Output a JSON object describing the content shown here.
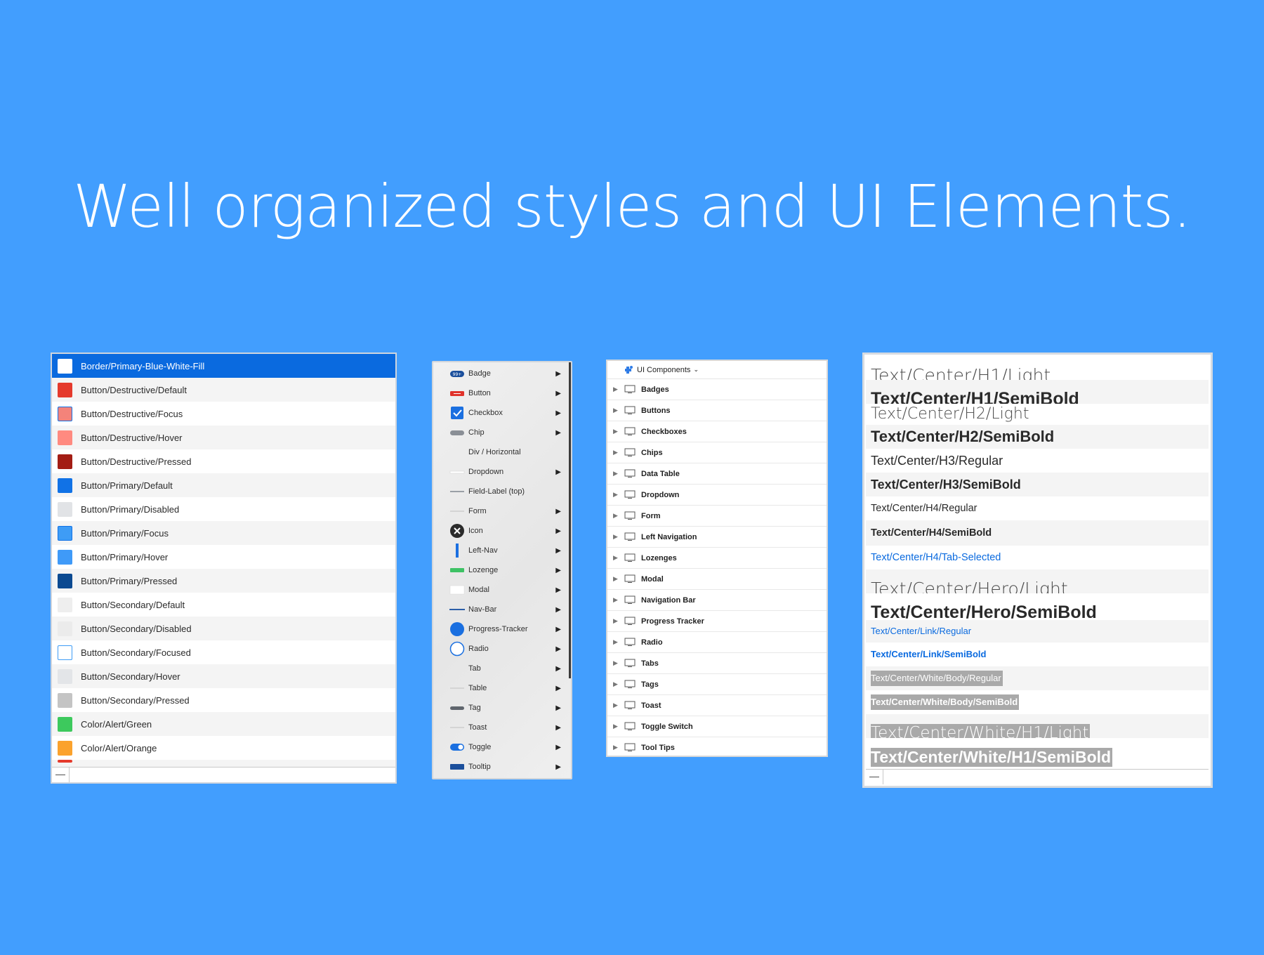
{
  "headline": "Well organized styles and UI Elements.",
  "colors": {
    "background": "#429EFE",
    "selected": "#0A6ADF",
    "link": "#0A6ADF",
    "highlight": "#A9A9A9"
  },
  "color_styles": {
    "items": [
      {
        "label": "Border/Primary-Blue-White-Fill",
        "swatch": "#FFFFFF",
        "selected": true
      },
      {
        "label": "Button/Destructive/Default",
        "swatch": "#E53A2C"
      },
      {
        "label": "Button/Destructive/Focus",
        "swatch": "#F4837A"
      },
      {
        "label": "Button/Destructive/Hover",
        "swatch": "#FF8A80"
      },
      {
        "label": "Button/Destructive/Pressed",
        "swatch": "#A31D14"
      },
      {
        "label": "Button/Primary/Default",
        "swatch": "#1172E6"
      },
      {
        "label": "Button/Primary/Disabled",
        "swatch": "#E1E3E6"
      },
      {
        "label": "Button/Primary/Focus",
        "swatch": "#3E9CF6"
      },
      {
        "label": "Button/Primary/Hover",
        "swatch": "#3F9AF8"
      },
      {
        "label": "Button/Primary/Pressed",
        "swatch": "#0C4A91"
      },
      {
        "label": "Button/Secondary/Default",
        "swatch": "#EEEEEE"
      },
      {
        "label": "Button/Secondary/Disabled",
        "swatch": "#EBEBEB"
      },
      {
        "label": "Button/Secondary/Focused",
        "swatch": "#FFFFFF"
      },
      {
        "label": "Button/Secondary/Hover",
        "swatch": "#E3E5E8"
      },
      {
        "label": "Button/Secondary/Pressed",
        "swatch": "#C4C4C4"
      },
      {
        "label": "Color/Alert/Green",
        "swatch": "#3DC95D"
      },
      {
        "label": "Color/Alert/Orange",
        "swatch": "#FBA22D"
      }
    ]
  },
  "component_menu": {
    "items": [
      {
        "label": "Badge",
        "icon": "badge-icon",
        "arrow": true
      },
      {
        "label": "Button",
        "icon": "button-icon",
        "arrow": true
      },
      {
        "label": "Checkbox",
        "icon": "checkbox-icon",
        "arrow": true
      },
      {
        "label": "Chip",
        "icon": "chip-icon",
        "arrow": true
      },
      {
        "label": "Div / Horizontal",
        "icon": "",
        "arrow": false
      },
      {
        "label": "Dropdown",
        "icon": "dropdown-icon",
        "arrow": true
      },
      {
        "label": "Field-Label (top)",
        "icon": "field-label-icon",
        "arrow": false
      },
      {
        "label": "Form",
        "icon": "form-icon",
        "arrow": true
      },
      {
        "label": "Icon",
        "icon": "close-circle-icon",
        "arrow": true
      },
      {
        "label": "Left-Nav",
        "icon": "left-nav-icon",
        "arrow": true
      },
      {
        "label": "Lozenge",
        "icon": "lozenge-icon",
        "arrow": true
      },
      {
        "label": "Modal",
        "icon": "modal-icon",
        "arrow": true
      },
      {
        "label": "Nav-Bar",
        "icon": "nav-bar-icon",
        "arrow": true
      },
      {
        "label": "Progress-Tracker",
        "icon": "progress-tracker-icon",
        "arrow": true
      },
      {
        "label": "Radio",
        "icon": "radio-icon",
        "arrow": true
      },
      {
        "label": "Tab",
        "icon": "",
        "arrow": true
      },
      {
        "label": "Table",
        "icon": "table-icon",
        "arrow": true
      },
      {
        "label": "Tag",
        "icon": "tag-icon",
        "arrow": true
      },
      {
        "label": "Toast",
        "icon": "toast-icon",
        "arrow": true
      },
      {
        "label": "Toggle",
        "icon": "toggle-icon",
        "arrow": true
      },
      {
        "label": "Tooltip",
        "icon": "tooltip-icon",
        "arrow": true
      }
    ],
    "badge_text": "99+"
  },
  "components_tree": {
    "header": "UI Components",
    "items": [
      "Badges",
      "Buttons",
      "Checkboxes",
      "Chips",
      "Data Table",
      "Dropdown",
      "Form",
      "Left Navigation",
      "Lozenges",
      "Modal",
      "Navigation Bar",
      "Progress Tracker",
      "Radio",
      "Tabs",
      "Tags",
      "Toast",
      "Toggle Switch",
      "Tool Tips"
    ]
  },
  "text_styles": {
    "items": [
      {
        "label": "Text/Center/H1/Light",
        "weight": "light",
        "style": "h1"
      },
      {
        "label": "Text/Center/H1/SemiBold",
        "weight": "bold",
        "style": "h1"
      },
      {
        "label": "Text/Center/H2/Light",
        "weight": "light",
        "style": "h2"
      },
      {
        "label": "Text/Center/H2/SemiBold",
        "weight": "bold",
        "style": "h2"
      },
      {
        "label": "Text/Center/H3/Regular",
        "weight": "regular",
        "style": "h3"
      },
      {
        "label": "Text/Center/H3/SemiBold",
        "weight": "bold",
        "style": "h3"
      },
      {
        "label": "Text/Center/H4/Regular",
        "weight": "regular",
        "style": "h4"
      },
      {
        "label": "Text/Center/H4/SemiBold",
        "weight": "bold",
        "style": "h4"
      },
      {
        "label": "Text/Center/H4/Tab-Selected",
        "weight": "regular",
        "style": "h4-link"
      },
      {
        "label": "Text/Center/Hero/Light",
        "weight": "light",
        "style": "hero"
      },
      {
        "label": "Text/Center/Hero/SemiBold",
        "weight": "bold",
        "style": "hero"
      },
      {
        "label": "Text/Center/Link/Regular",
        "weight": "regular",
        "style": "link"
      },
      {
        "label": "Text/Center/Link/SemiBold",
        "weight": "bold",
        "style": "link"
      },
      {
        "label": "Text/Center/White/Body/Regular",
        "weight": "regular",
        "style": "white-body"
      },
      {
        "label": "Text/Center/White/Body/SemiBold",
        "weight": "bold",
        "style": "white-body"
      },
      {
        "label": "Text/Center/White/H1/Light",
        "weight": "light",
        "style": "white-h1"
      },
      {
        "label": "Text/Center/White/H1/SemiBold",
        "weight": "bold",
        "style": "white-h1"
      }
    ]
  },
  "footer": {
    "minus_label": "—"
  }
}
